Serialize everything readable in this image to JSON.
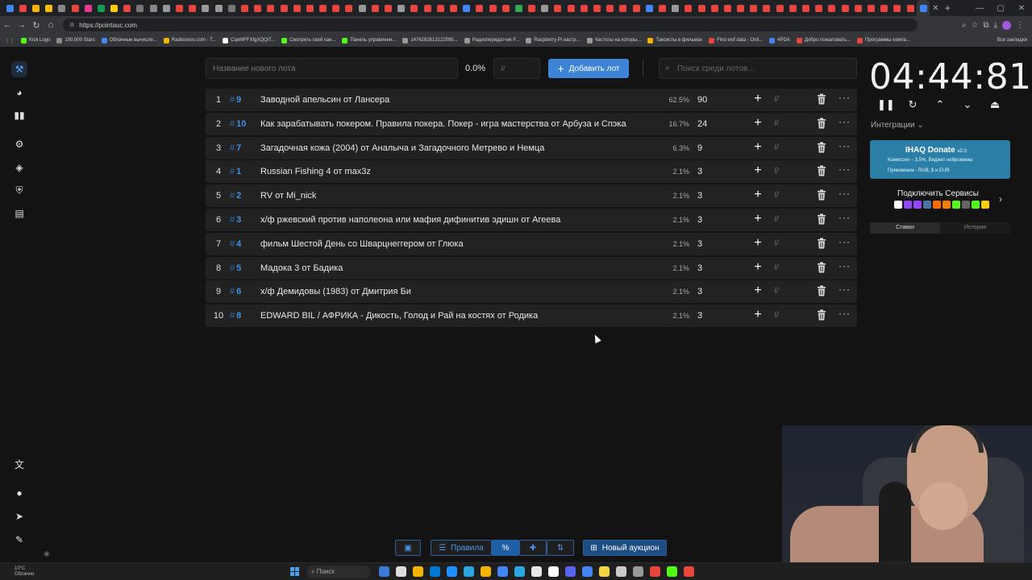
{
  "browser": {
    "url": "https://pointauc.com",
    "tab_colors": [
      "#4285f4",
      "#e8453c",
      "#f4b400",
      "#fbbc05",
      "#888",
      "#e8453c",
      "#e83c8a",
      "#0f9d58",
      "#ffcc00",
      "#e8453c",
      "#777",
      "#888",
      "#999",
      "#e8453c",
      "#e8453c",
      "#999",
      "#999",
      "#777",
      "#e8453c",
      "#e8453c",
      "#e8453c",
      "#e8453c",
      "#e8453c",
      "#e8453c",
      "#e8453c",
      "#e8453c",
      "#e8453c",
      "#999",
      "#e8453c",
      "#e8453c",
      "#999",
      "#e8453c",
      "#e8453c",
      "#e8453c",
      "#e8453c",
      "#4285f4",
      "#e8453c",
      "#e8453c",
      "#e8453c",
      "#34a853",
      "#e8453c",
      "#999",
      "#e8453c",
      "#e8453c",
      "#e8453c",
      "#e8453c",
      "#e8453c",
      "#e8453c",
      "#e8453c",
      "#4285f4",
      "#e8453c",
      "#999",
      "#e8453c",
      "#e8453c",
      "#e8453c",
      "#e8453c",
      "#e8453c",
      "#e8453c",
      "#e8453c",
      "#e8453c",
      "#e8453c",
      "#e8453c",
      "#e8453c",
      "#e8453c",
      "#e8453c",
      "#e8453c",
      "#e8453c",
      "#e8453c",
      "#e8453c",
      "#e8453c",
      "#4285f4"
    ],
    "bookmarks": [
      {
        "label": "Kick Logo",
        "color": "#53fc18"
      },
      {
        "label": "100,000 Stars",
        "color": "#888"
      },
      {
        "label": "Облачные вычисле...",
        "color": "#4285f4"
      },
      {
        "label": "Radiooooo.com - T...",
        "color": "#f4b400"
      },
      {
        "label": "CqeMFFXfgXQQiT...",
        "color": "#fff"
      },
      {
        "label": "Смотреть свой кан...",
        "color": "#53fc18"
      },
      {
        "label": "Панель управлени...",
        "color": "#53fc18"
      },
      {
        "label": "1476282613122595...",
        "color": "#999"
      },
      {
        "label": "Радиопередатчик F...",
        "color": "#999"
      },
      {
        "label": "Raspberry Pi настр...",
        "color": "#999"
      },
      {
        "label": "Частоты на которы...",
        "color": "#999"
      },
      {
        "label": "Таксисты в фильмах",
        "color": "#f4b400"
      },
      {
        "label": "Find exif data - Onli...",
        "color": "#e8453c"
      },
      {
        "label": "4PDA",
        "color": "#4285f4"
      },
      {
        "label": "Добро пожаловать...",
        "color": "#e8453c"
      },
      {
        "label": "Программы компа...",
        "color": "#e8453c"
      }
    ],
    "bookmarks_right": "Все закладки"
  },
  "toolbar": {
    "lot_name_placeholder": "Название нового лота",
    "percent": "0.0%",
    "amount_placeholder": "₽",
    "add_label": "Добавить лот",
    "search_placeholder": "Поиск среди лотов..."
  },
  "lots": [
    {
      "n": "1",
      "id": "9",
      "title": "Заводной апельсин от Лансера",
      "pct": "62.5%",
      "amount": "90"
    },
    {
      "n": "2",
      "id": "10",
      "title": "Как зарабатывать покером. Правила покера. Покер - игра мастерства от Арбуза и Спэка",
      "pct": "16.7%",
      "amount": "24"
    },
    {
      "n": "3",
      "id": "7",
      "title": "Загадочная кожа (2004) от Аналыча и Загадочного Метрево и Немца",
      "pct": "6.3%",
      "amount": "9"
    },
    {
      "n": "4",
      "id": "1",
      "title": "Russian Fishing 4 от max3z",
      "pct": "2.1%",
      "amount": "3"
    },
    {
      "n": "5",
      "id": "2",
      "title": "RV от Mi_nick",
      "pct": "2.1%",
      "amount": "3"
    },
    {
      "n": "6",
      "id": "3",
      "title": "х/ф ржевский против наполеона или мафия дифинитив эдишн от Агеева",
      "pct": "2.1%",
      "amount": "3"
    },
    {
      "n": "7",
      "id": "4",
      "title": " фильм Шестой День со Шварцнеггером от Глюка",
      "pct": "2.1%",
      "amount": "3"
    },
    {
      "n": "8",
      "id": "5",
      "title": "Мадока 3 от Бадика",
      "pct": "2.1%",
      "amount": "3"
    },
    {
      "n": "9",
      "id": "6",
      "title": "х/ф Демидовы (1983) от Дмитрия Би",
      "pct": "2.1%",
      "amount": "3"
    },
    {
      "n": "10",
      "id": "8",
      "title": "EDWARD BIL / АФРИКА - Дикость, Голод и Рай на костях от Родика",
      "pct": "2.1%",
      "amount": "3"
    }
  ],
  "lot_symbols": {
    "hash": "#",
    "plus": "+",
    "rub": "₽",
    "more": "···"
  },
  "timer": {
    "value": "04:44:81"
  },
  "integrations": {
    "label": "Интеграции ⌄"
  },
  "donate": {
    "title": "IHAQ Donate",
    "version": "v2.0",
    "line1": "Комиссия – 3,5%, Виджет нейромемы",
    "line2": "Принимаем - RUB, $ и EUR"
  },
  "connect": {
    "label": "Подключить Сервисы",
    "icon_colors": [
      "#fff",
      "#9146ff",
      "#9146ff",
      "#4c75a3",
      "#ff6a00",
      "#f57d00",
      "#53fc18",
      "#666",
      "#53fc18",
      "#ffcc00"
    ]
  },
  "side_tabs": {
    "bets": "Ставки",
    "history": "История"
  },
  "bottom": {
    "rules": "Правила",
    "new_auction": "Новый аукцион"
  },
  "taskbar": {
    "weather_temp": "10°C",
    "weather_text": "Облачно",
    "search": "Поиск",
    "app_colors": [
      "#3a7bd5",
      "#ddd",
      "#f4b400",
      "#0078d4",
      "#1e90ff",
      "#2aa7e1",
      "#f4b400",
      "#4285f4",
      "#2aa7e1",
      "#e8e8e8",
      "#fff",
      "#5865f2",
      "#4285f4",
      "#f5d442",
      "#ccc",
      "#999",
      "#e8453c",
      "#53fc18",
      "#e8453c"
    ]
  }
}
